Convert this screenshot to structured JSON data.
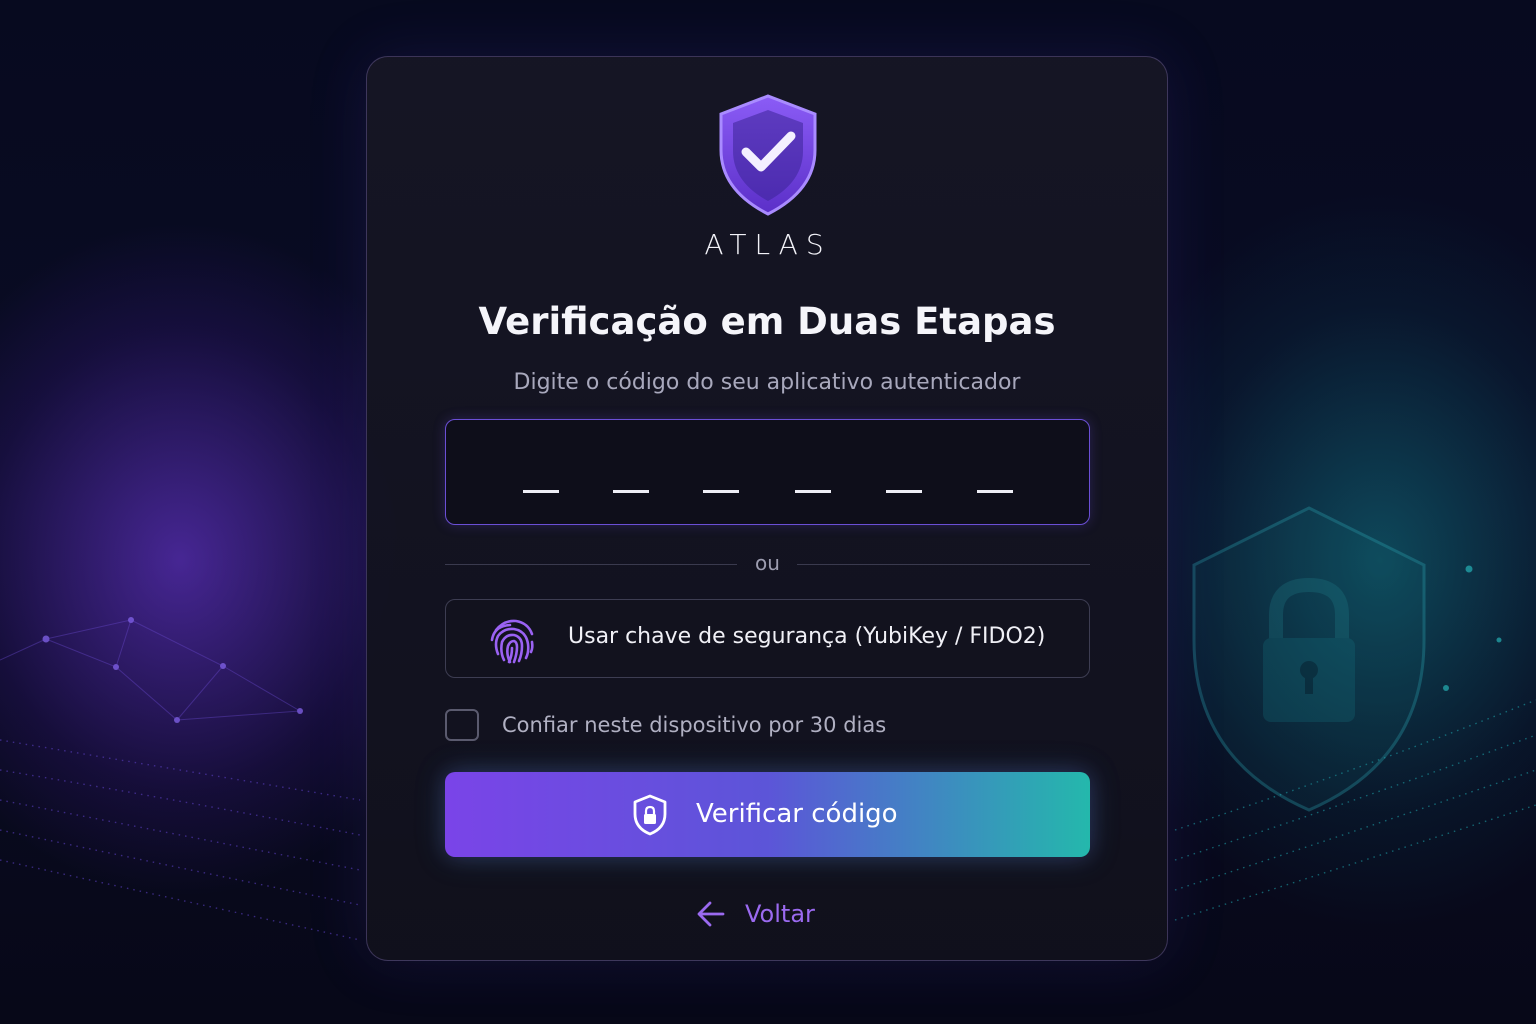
{
  "brand": {
    "name": "ATLAS",
    "logo_icon": "shield-check-icon"
  },
  "page": {
    "title": "Verificação em Duas Etapas",
    "subtitle": "Digite o código do seu aplicativo autenticador"
  },
  "code_input": {
    "digits": [
      "",
      "",
      "",
      "",
      "",
      ""
    ],
    "slot_count": 6
  },
  "divider": {
    "label": "ou"
  },
  "security_key": {
    "label": "Usar chave de segurança (YubiKey / FIDO2)",
    "icon": "fingerprint-icon"
  },
  "trust_device": {
    "label": "Confiar neste dispositivo por 30 dias",
    "checked": false
  },
  "verify_button": {
    "label": "Verificar código",
    "icon": "shield-lock-icon"
  },
  "back_link": {
    "label": "Voltar",
    "icon": "arrow-left-icon"
  },
  "colors": {
    "accent_purple": "#7a44e8",
    "accent_teal": "#24b8ac",
    "link": "#9b6af0",
    "background": "#06081a"
  }
}
